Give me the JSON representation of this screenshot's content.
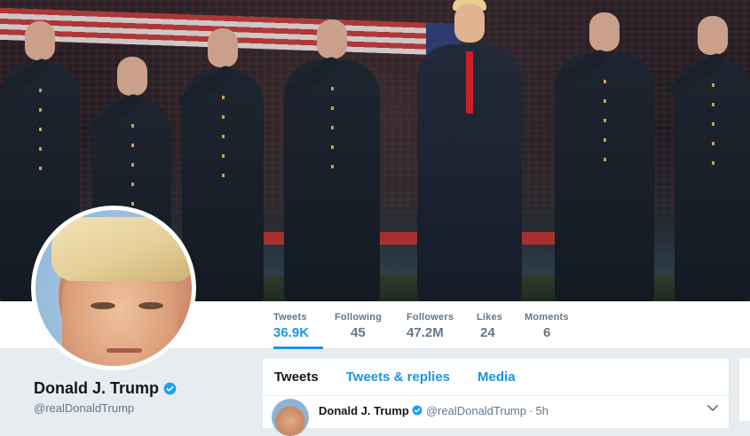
{
  "profile": {
    "name": "Donald J. Trump",
    "handle": "@realDonaldTrump"
  },
  "stats": [
    {
      "label": "Tweets",
      "value": "36.9K",
      "active": true
    },
    {
      "label": "Following",
      "value": "45"
    },
    {
      "label": "Followers",
      "value": "47.2M"
    },
    {
      "label": "Likes",
      "value": "24"
    },
    {
      "label": "Moments",
      "value": "6"
    }
  ],
  "tabs": [
    "Tweets",
    "Tweets & replies",
    "Media"
  ],
  "tweet": {
    "name": "Donald J. Trump",
    "handle": "@realDonaldTrump",
    "separator": "·",
    "time": "5h"
  },
  "colors": {
    "accent": "#1b95e0",
    "text": "#14171a",
    "muted": "#657786",
    "background": "#e6ecf0"
  },
  "icons": {
    "verified": "verified-badge-icon",
    "caret": "chevron-down-icon"
  }
}
